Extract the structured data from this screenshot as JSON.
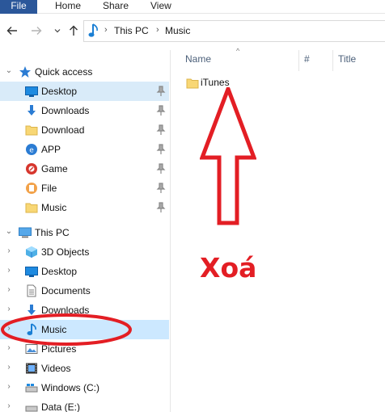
{
  "ribbon": {
    "tabs": [
      "File",
      "Home",
      "Share",
      "View"
    ]
  },
  "address_bar": {
    "path": [
      "This PC",
      "Music"
    ]
  },
  "nav_pane": {
    "quick_access": {
      "label": "Quick access",
      "items": [
        {
          "label": "Desktop",
          "icon": "desktop-icon",
          "pinned": true
        },
        {
          "label": "Downloads",
          "icon": "downloads-icon",
          "pinned": true
        },
        {
          "label": "Download",
          "icon": "folder-icon",
          "pinned": true
        },
        {
          "label": "APP",
          "icon": "app-icon",
          "pinned": true
        },
        {
          "label": "Game",
          "icon": "game-icon",
          "pinned": true
        },
        {
          "label": "File",
          "icon": "file-icon",
          "pinned": true
        },
        {
          "label": "Music",
          "icon": "folder-icon",
          "pinned": true
        }
      ]
    },
    "this_pc": {
      "label": "This PC",
      "items": [
        {
          "label": "3D Objects",
          "icon": "3d-objects-icon"
        },
        {
          "label": "Desktop",
          "icon": "desktop-icon"
        },
        {
          "label": "Documents",
          "icon": "documents-icon"
        },
        {
          "label": "Downloads",
          "icon": "downloads-icon"
        },
        {
          "label": "Music",
          "icon": "music-icon",
          "selected": true
        },
        {
          "label": "Pictures",
          "icon": "pictures-icon"
        },
        {
          "label": "Videos",
          "icon": "videos-icon"
        },
        {
          "label": "Windows (C:)",
          "icon": "drive-icon"
        },
        {
          "label": "Data (E:)",
          "icon": "drive-icon"
        }
      ]
    }
  },
  "content": {
    "columns": [
      "Name",
      "#",
      "Title"
    ],
    "files": [
      {
        "name": "iTunes",
        "icon": "folder-icon"
      }
    ]
  },
  "annotation": {
    "text": "Xoá",
    "color": "#e31e24"
  }
}
